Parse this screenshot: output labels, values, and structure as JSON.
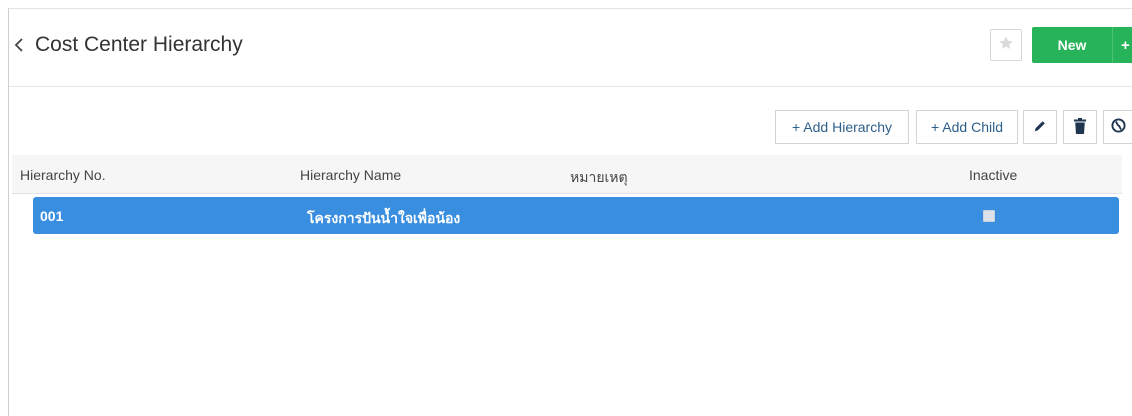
{
  "header": {
    "title": "Cost Center Hierarchy",
    "new_label": "New",
    "new_plus": "+"
  },
  "toolbar": {
    "add_hierarchy": "+ Add Hierarchy",
    "add_child": "+ Add Child"
  },
  "table": {
    "columns": [
      "Hierarchy No.",
      "Hierarchy Name",
      "หมายเหตุ",
      "Inactive"
    ],
    "rows": [
      {
        "no": "001",
        "name": "โครงการปันน้ำใจเพื่อน้อง",
        "remark": "",
        "inactive": false
      }
    ]
  },
  "colors": {
    "accent_green": "#27b35a",
    "selected_row": "#3a8ee0",
    "link_blue": "#2d5f8b"
  },
  "icons": [
    "back-chevron-icon",
    "star-icon",
    "edit-icon",
    "delete-icon",
    "globe-icon"
  ]
}
